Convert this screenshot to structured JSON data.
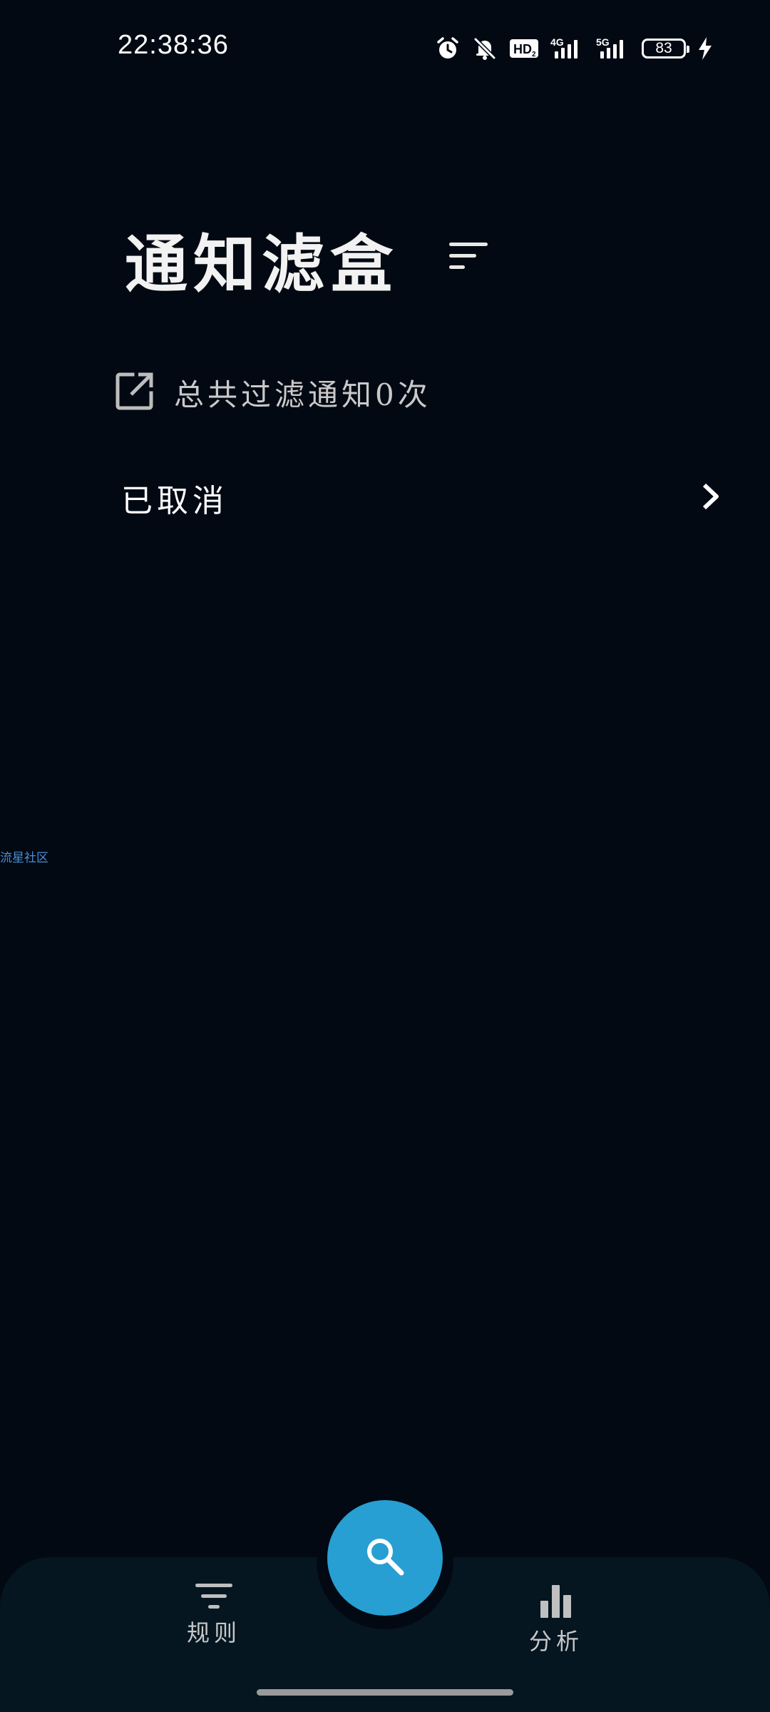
{
  "status_bar": {
    "time": "22:38:36",
    "battery_level": "83",
    "icons": [
      "alarm-icon",
      "bell-off-icon",
      "hd-icon",
      "signal-4g-icon",
      "signal-5g-icon",
      "battery-icon",
      "charging-bolt-icon"
    ],
    "hd_label": "HD",
    "net1_label": "4G",
    "net2_label": "5G"
  },
  "header": {
    "title": "通知滤盒",
    "sort_icon": "sort-filter-icon"
  },
  "stats": {
    "icon": "open-external-icon",
    "text": "总共过滤通知0次"
  },
  "list": {
    "items": [
      {
        "label": "已取消",
        "icon": "chevron-right-icon"
      }
    ]
  },
  "watermark": {
    "text": "流星社区"
  },
  "bottom_nav": {
    "items": [
      {
        "label": "规则",
        "icon": "filter-lines-icon"
      },
      {
        "label": "分析",
        "icon": "bar-chart-icon"
      }
    ],
    "fab_icon": "search-icon"
  },
  "colors": {
    "background": "#020913",
    "bottom_bar": "#051621",
    "fab": "#279fd2",
    "watermark": "#4a8fd4"
  }
}
